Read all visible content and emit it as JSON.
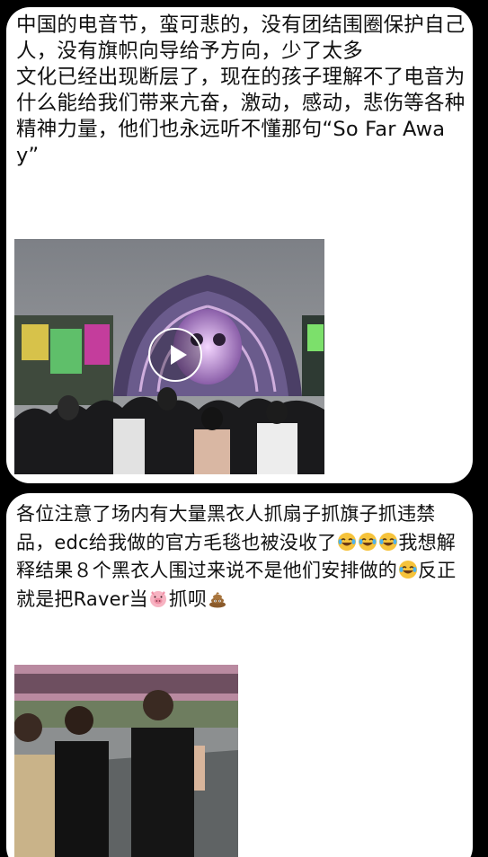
{
  "posts": [
    {
      "paragraph_1": "中国的电音节，蛮可悲的，没有团结围圈保护自己人，没有旗帜向导给予方向，少了太多",
      "paragraph_2": "文化已经出现断层了，现在的孩子理解不了电音为什么能给我们带来亢奋，激动，感动，悲伤等各种精神力量，他们也永远听不懂那句“So Far Away”",
      "media": {
        "type": "video",
        "icon": "play-icon",
        "description_icon": "stage-scene"
      }
    },
    {
      "text_part_1": "各位注意了场内有大量黑衣人抓扇子抓旗子抓违禁品，edc给我做的官方毛毯也被没收了",
      "text_part_2": "我想解释结果８个黑衣人围过来说不是他们安排做的",
      "text_part_3": "反正就是把Raver当",
      "text_part_4": "抓呗",
      "emojis": {
        "laughing": "face-with-tears-of-joy-icon",
        "pig": "pig-face-icon",
        "poop": "pile-of-poo-icon"
      },
      "media": {
        "type": "image"
      }
    }
  ],
  "colors": {
    "background": "#000000",
    "card": "#ffffff",
    "text": "#111111"
  }
}
